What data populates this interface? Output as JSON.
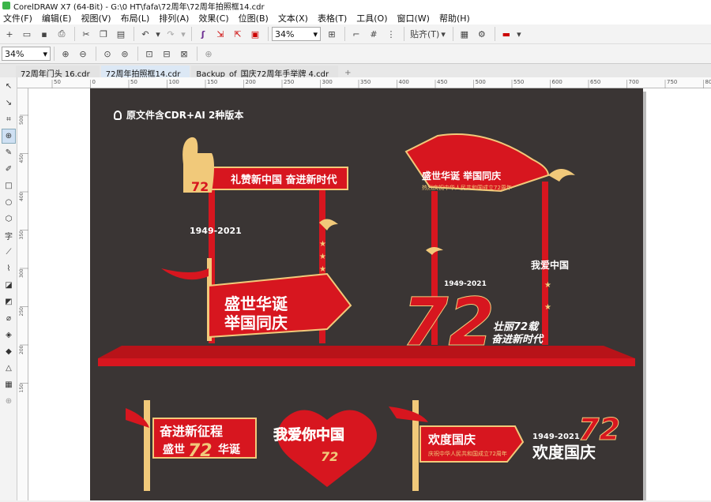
{
  "window": {
    "title": "CorelDRAW X7 (64-Bit) - G:\\0 HT\\fafa\\72周年\\72周年拍照框14.cdr"
  },
  "menu": [
    "文件(F)",
    "编辑(E)",
    "视图(V)",
    "布局(L)",
    "排列(A)",
    "效果(C)",
    "位图(B)",
    "文本(X)",
    "表格(T)",
    "工具(O)",
    "窗口(W)",
    "帮助(H)"
  ],
  "toolbar": {
    "zoom": "34%",
    "snap_label": "贴齐(T)"
  },
  "property_bar": {
    "zoom": "34%"
  },
  "tabs": [
    "72周年门头 16.cdr",
    "72周年拍照框14.cdr",
    "Backup_of_国庆72周年手举牌 4.cdr"
  ],
  "ruler_top": [
    "50",
    "0",
    "50",
    "100",
    "150",
    "200",
    "250",
    "300",
    "350",
    "400",
    "450",
    "500",
    "550",
    "600",
    "650",
    "700",
    "750",
    "800"
  ],
  "ruler_left": [
    "500",
    "450",
    "400",
    "350",
    "300",
    "250",
    "200",
    "150"
  ],
  "artwork": {
    "caption": "原文件含CDR+AI 2种版本",
    "frame1": {
      "banner": "礼赞新中国 奋进新时代",
      "year": "1949-2021",
      "main1": "盛世华诞",
      "main2": "举国同庆",
      "num": "72"
    },
    "frame2": {
      "flag_title": "盛世华诞 举国同庆",
      "flag_sub": "热烈庆祝中华人民共和国成立72周年",
      "side": "我爱中国",
      "num": "72",
      "years": "1949-2021",
      "slogan1": "壮丽72载",
      "slogan2": "奋进新时代"
    },
    "sign1": {
      "line1": "奋进新征程",
      "line2a": "盛世",
      "num": "72",
      "line2b": "华诞"
    },
    "sign2": {
      "text": "我爱你中国",
      "num": "72"
    },
    "sign3": {
      "title": "欢度国庆",
      "sub": "庆祝中华人民共和国成立72周年"
    },
    "sign4": {
      "years": "1949-2021",
      "num": "72",
      "title": "欢度国庆"
    }
  },
  "colors": {
    "artboard": "#3a3534",
    "red": "#d7161f",
    "gold": "#f1c97a"
  }
}
